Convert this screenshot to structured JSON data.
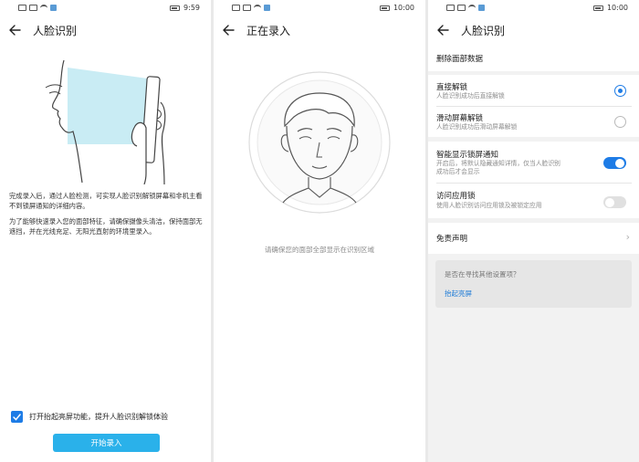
{
  "status": {
    "left_glyphs": "4G ᵢᵢ ◉",
    "s1_time": "9:59",
    "s2_time": "10:00",
    "s3_time": "10:00"
  },
  "screen1": {
    "title": "人脸识别",
    "para1": "完成录入后，通过人脸检测，可实现人脸识别解锁屏幕和非机主看不到锁屏通知的详细内容。",
    "para2": "为了能够快速录入您的面部特征，请确保摄像头清洁，保持面部无遮挡，并在光线充足、无阳光直射的环境里录入。",
    "checkbox_label": "打开抬起亮屏功能，提升人脸识别解锁体验",
    "checkbox_checked": true,
    "start_button": "开始录入"
  },
  "screen2": {
    "title": "正在录入",
    "hint": "请确保您的面部全部显示在识别区域"
  },
  "screen3": {
    "title": "人脸识别",
    "delete_link": "删除面部数据",
    "unlock_direct": {
      "title": "直接解锁",
      "subtitle": "人脸识别成功后直接解锁",
      "selected": true
    },
    "unlock_slide": {
      "title": "滑动屏幕解锁",
      "subtitle": "人脸识别成功后滑动屏幕解锁",
      "selected": false
    },
    "smart_notify": {
      "title": "智能显示锁屏通知",
      "subtitle_line1": "开启后，将默认隐藏通知详情，仅当人脸识别",
      "subtitle_line2": "成功后才会显示",
      "enabled": true
    },
    "app_lock": {
      "title": "访问应用锁",
      "subtitle": "使用人脸识别访问应用锁及被锁定应用",
      "enabled": false
    },
    "disclaimer": "免责声明",
    "suggest_question": "是否在寻找其他设置项？",
    "suggest_link": "抬起亮屏"
  },
  "colors": {
    "accent": "#1e7ce6",
    "button": "#2ab1ea",
    "link": "#1a79d6",
    "beam": "#bfe9f2"
  }
}
